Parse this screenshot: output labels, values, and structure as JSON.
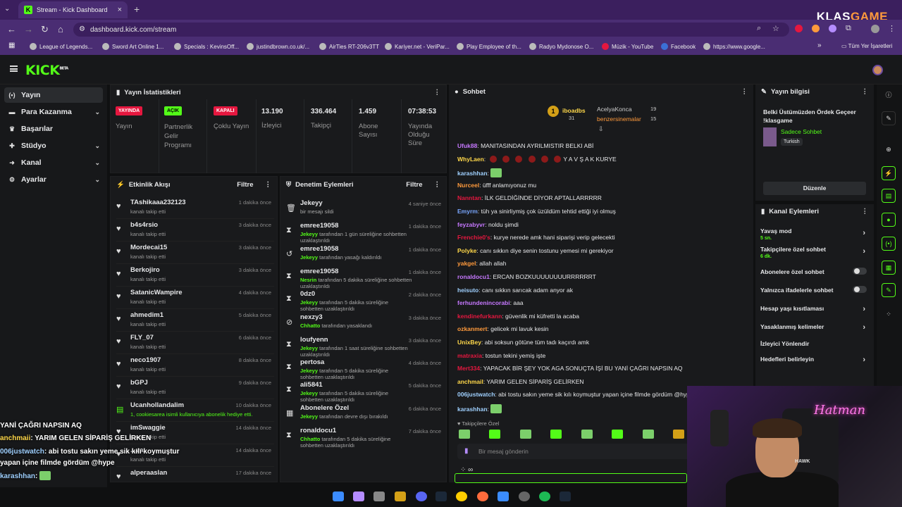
{
  "browser": {
    "tab_title": "Stream - Kick Dashboard",
    "url": "dashboard.kick.com/stream",
    "brand_a": "KLAS",
    "brand_b": "GAME",
    "bookmarks": [
      "League of Legends...",
      "Sword Art Online 1...",
      "Specials : KevinsOff...",
      "justindbrown.co.uk/...",
      "AirTies RT-206v3TT",
      "Kariyer.net - VeriPar...",
      "Play Employee of th...",
      "Radyo Mydonose O...",
      "Müzik - YouTube",
      "Facebook",
      "https://www.google..."
    ],
    "all_bookmarks": "Tüm Yer İşaretleri"
  },
  "kick": {
    "logo": "KICK",
    "beta": "BETA"
  },
  "sidebar": [
    {
      "label": "Yayın",
      "icon": "broadcast-icon"
    },
    {
      "label": "Para Kazanma",
      "icon": "money-icon"
    },
    {
      "label": "Başarılar",
      "icon": "trophy-icon"
    },
    {
      "label": "Stüdyo",
      "icon": "studio-icon"
    },
    {
      "label": "Kanal",
      "icon": "channel-icon"
    },
    {
      "label": "Ayarlar",
      "icon": "gear-icon"
    }
  ],
  "stats": {
    "title": "Yayın İstatistikleri",
    "badges": [
      {
        "badge": "YAYINDA",
        "label": "Yayın"
      },
      {
        "badge": "AÇIK",
        "label": "Partnerlik Gelir Programı"
      },
      {
        "badge": "KAPALI",
        "label": "Çoklu Yayın"
      }
    ],
    "numbers": [
      {
        "value": "13.190",
        "label": "İzleyici"
      },
      {
        "value": "336.464",
        "label": "Takipçi"
      },
      {
        "value": "1.459",
        "label": "Abone Sayısı"
      },
      {
        "value": "07:38:53",
        "label": "Yayında Olduğu Süre"
      }
    ]
  },
  "activity": {
    "title": "Etkinlik Akışı",
    "filter": "Filtre",
    "items": [
      {
        "name": "TAshikaaa232123",
        "sub": "kanalı takip etti",
        "time": "1 dakika önce"
      },
      {
        "name": "b4s4rsio",
        "sub": "kanalı takip etti",
        "time": "3 dakika önce"
      },
      {
        "name": "Mordecai15",
        "sub": "kanalı takip etti",
        "time": "3 dakika önce"
      },
      {
        "name": "Berkojiro",
        "sub": "kanalı takip etti",
        "time": "3 dakika önce"
      },
      {
        "name": "SatanicWampire",
        "sub": "kanalı takip etti",
        "time": "4 dakika önce"
      },
      {
        "name": "ahmedim1",
        "sub": "kanalı takip etti",
        "time": "5 dakika önce"
      },
      {
        "name": "FLY_07",
        "sub": "kanalı takip etti",
        "time": "6 dakika önce"
      },
      {
        "name": "neco1907",
        "sub": "kanalı takip etti",
        "time": "8 dakika önce"
      },
      {
        "name": "bGPJ",
        "sub": "kanalı takip etti",
        "time": "9 dakika önce"
      },
      {
        "name": "Ucanhollandalim",
        "sub": "1, cookiesarea isimli kullanıcıya abonelik hediye etti.",
        "time": "10 dakika önce"
      },
      {
        "name": "imSwaggie",
        "sub": "kanalı takip etti",
        "time": "14 dakika önce"
      },
      {
        "name": "...va",
        "sub": "kanalı takip etti",
        "time": "14 dakika önce"
      },
      {
        "name": "alperaaslan",
        "sub": "",
        "time": "17 dakika önce"
      }
    ]
  },
  "moderation": {
    "title": "Denetim Eylemleri",
    "filter": "Filtre",
    "items": [
      {
        "name": "Jekeyy",
        "mod": "",
        "text": "bir mesajı sildi",
        "time": "4 saniye önce",
        "icon": "trash-icon"
      },
      {
        "name": "emree19058",
        "mod": "Jekeyy",
        "text": "tarafından 1 gün süreliğine sohbetten uzaklaştırıldı",
        "time": "1 dakika önce",
        "icon": "hourglass-icon"
      },
      {
        "name": "emree19058",
        "mod": "Jekeyy",
        "text": "tarafından yasağı kaldırıldı",
        "time": "1 dakika önce",
        "icon": "undo-icon"
      },
      {
        "name": "emree19058",
        "mod": "Nesrin",
        "text": "tarafından 5 dakika süreliğine sohbetten uzaklaştırıldı",
        "time": "1 dakika önce",
        "icon": "hourglass-icon"
      },
      {
        "name": "0dz0",
        "mod": "Jekeyy",
        "text": "tarafından 5 dakika süreliğine sohbetten uzaklaştırıldı",
        "time": "2 dakika önce",
        "icon": "hourglass-icon"
      },
      {
        "name": "nexzy3",
        "mod": "Chhatto",
        "text": "tarafından yasaklandı",
        "time": "3 dakika önce",
        "icon": "ban-icon"
      },
      {
        "name": "loufyenn",
        "mod": "Jekeyy",
        "text": "tarafından 1 saat süreliğine sohbetten uzaklaştırıldı",
        "time": "3 dakika önce",
        "icon": "hourglass-icon"
      },
      {
        "name": "pertosa",
        "mod": "Jekeyy",
        "text": "tarafından 5 dakika süreliğine sohbetten uzaklaştırıldı",
        "time": "4 dakika önce",
        "icon": "hourglass-icon"
      },
      {
        "name": "ali5841",
        "mod": "Jekeyy",
        "text": "tarafından 5 dakika süreliğine sohbetten uzaklaştırıldı",
        "time": "5 dakika önce",
        "icon": "hourglass-icon"
      },
      {
        "name": "Abonelere Özel",
        "mod": "Jekeyy",
        "text": "tarafından devre dışı bırakıldı",
        "time": "6 dakika önce",
        "icon": "gift-icon"
      },
      {
        "name": "ronaldocu1",
        "mod": "Chhatto",
        "text": "tarafından 5 dakika süreliğine sohbetten uzaklaştırıldı",
        "time": "7 dakika önce",
        "icon": "hourglass-icon"
      }
    ]
  },
  "chat": {
    "title": "Sohbet",
    "top": [
      {
        "rank": "1",
        "name": "iboadbs",
        "count": "31"
      },
      {
        "name": "AcelyaKonca",
        "count": "19"
      },
      {
        "name": "benzersinemalar",
        "count": "15"
      }
    ],
    "messages": [
      {
        "user": "Ufuk88",
        "color": "#c678ff",
        "text": "MANITASINDAN AYRILMISTIR BELKI ABİ"
      },
      {
        "user": "WhyLaen",
        "color": "#ffd84a",
        "text": "Y A V Ş A K KURYE"
      },
      {
        "user": "karashhan",
        "color": "#9fd0ff",
        "text": ""
      },
      {
        "user": "Nurceel",
        "color": "#ff9a3c",
        "text": "üfff anlamıyonuz mu"
      },
      {
        "user": "Nanntan",
        "color": "#e5173f",
        "text": "İLK GELDİĞİNDE DİYOR APTALLARRRRR"
      },
      {
        "user": "Emyrm",
        "color": "#7aa7ff",
        "text": "tüh ya sinirliymiş çok üzüldüm tehtid ettiği iyi olmuş"
      },
      {
        "user": "feyzabyvr",
        "color": "#c678ff",
        "text": "noldu şimdi"
      },
      {
        "user": "Frenchie0's",
        "color": "#e5173f",
        "text": "kurye nerede amk hani siparişi verip gelecekti"
      },
      {
        "user": "Polyke",
        "color": "#ffd84a",
        "text": "canı sıkkın diye senin tostunu yemesi mi gerekiyor"
      },
      {
        "user": "yakgel",
        "color": "#ff9a3c",
        "text": "allah allah"
      },
      {
        "user": "ronaldocu1",
        "color": "#c678ff",
        "text": "ERCAN BOZKUUUUUUUURRRRRRT"
      },
      {
        "user": "heisuto",
        "color": "#9fd0ff",
        "text": "canı sıkkın sarıcak adam anyor ak"
      },
      {
        "user": "ferhundenincorabi",
        "color": "#c678ff",
        "text": "aaa"
      },
      {
        "user": "kendinefurkann",
        "color": "#e5173f",
        "text": "güvenlik mi küfretti la acaba"
      },
      {
        "user": "ozkanmert",
        "color": "#ff9a3c",
        "text": "gelicek mi lavuk kesin"
      },
      {
        "user": "UnixBey",
        "color": "#ffd84a",
        "text": "abi soksun götüne tüm tadı kaçırdı amk"
      },
      {
        "user": "matraxia",
        "color": "#e5173f",
        "text": "tostun tekini yemiş işte"
      },
      {
        "user": "Mert334",
        "color": "#e5173f",
        "text": "YAPACAK BİR ŞEY YOK AGA SONUÇTA İŞİ BU YANİ ÇAĞRI NAPSIN AQ"
      },
      {
        "user": "anchmail",
        "color": "#ffd84a",
        "text": "YARIM GELEN SİPARİŞ GELİRKEN"
      },
      {
        "user": "006justwatch",
        "color": "#9fd0ff",
        "text": "abi tostu sakın yeme sik kılı koymuştur yapan içine filmde gördüm @hype"
      },
      {
        "user": "karashhan",
        "color": "#9fd0ff",
        "text": ""
      }
    ],
    "followers_only": "Takipçilere Özel",
    "placeholder": "Bir mesaj gönderin",
    "infinity": "∞"
  },
  "stream_info": {
    "title": "Yayın bilgisi",
    "stream_title": "Belki Üstümüzden Ördek Geçeer !klasgame",
    "category": "Sadece Sohbet",
    "language": "Turkish",
    "edit": "Düzenle"
  },
  "channel_actions": {
    "title": "Kanal Eylemleri",
    "items": [
      {
        "label": "Yavaş mod",
        "sub": "5 sn.",
        "type": "arrow"
      },
      {
        "label": "Takipçilere özel sohbet",
        "sub": "6 dk.",
        "type": "arrow"
      },
      {
        "label": "Abonelere özel sohbet",
        "sub": "",
        "type": "toggle"
      },
      {
        "label": "Yalnızca ifadelerle sohbet",
        "sub": "",
        "type": "toggle"
      },
      {
        "label": "Hesap yaşı kısıtlaması",
        "sub": "",
        "type": "arrow"
      },
      {
        "label": "Yasaklanmış kelimeler",
        "sub": "",
        "type": "arrow"
      },
      {
        "label": "İzleyici Yönlendir",
        "sub": "",
        "type": "none"
      },
      {
        "label": "Hedefleri belirleyin",
        "sub": "",
        "type": "arrow"
      }
    ]
  },
  "overlay": [
    {
      "text": "YANİ ÇAĞRI NAPSIN AQ",
      "user": ""
    },
    {
      "user": "anchmaii",
      "text": ": YARIM GELEN SİPARİŞ GELİRKEN"
    },
    {
      "user": "006justwatch",
      "text": ": abi tostu sakın yeme sik kılı koymuştur"
    },
    {
      "user": "",
      "text": "yapan içine filmde gördüm @hype"
    },
    {
      "user": "karashhan",
      "text": ":"
    }
  ],
  "webcam": {
    "neon": "Hatman",
    "shirt": "HAWK"
  }
}
